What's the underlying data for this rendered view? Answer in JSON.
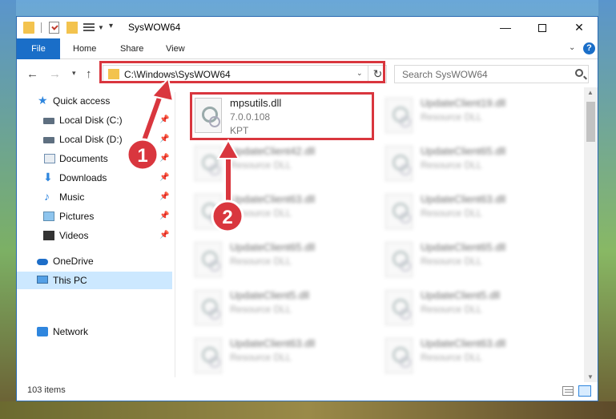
{
  "window": {
    "title": "SysWOW64"
  },
  "ribbon": {
    "tabs": [
      "File",
      "Home",
      "Share",
      "View"
    ]
  },
  "nav": {
    "address": "C:\\Windows\\SysWOW64",
    "search_placeholder": "Search SysWOW64"
  },
  "sidebar": {
    "items": [
      {
        "label": "Quick access",
        "icon": "star-icon",
        "pinned": false
      },
      {
        "label": "Local Disk (C:)",
        "icon": "disk-icon",
        "pinned": true
      },
      {
        "label": "Local Disk (D:)",
        "icon": "disk-icon",
        "pinned": true
      },
      {
        "label": "Documents",
        "icon": "documents-icon",
        "pinned": true
      },
      {
        "label": "Downloads",
        "icon": "download-icon",
        "pinned": true
      },
      {
        "label": "Music",
        "icon": "music-icon",
        "pinned": true
      },
      {
        "label": "Pictures",
        "icon": "pictures-icon",
        "pinned": true
      },
      {
        "label": "Videos",
        "icon": "videos-icon",
        "pinned": true
      },
      {
        "label": "OneDrive",
        "icon": "onedrive-icon",
        "pinned": false
      },
      {
        "label": "This PC",
        "icon": "pc-icon",
        "pinned": false,
        "selected": true
      },
      {
        "label": "Network",
        "icon": "network-icon",
        "pinned": false
      }
    ]
  },
  "files": [
    {
      "name": "mpsutils.dll",
      "line2": "7.0.0.108",
      "line3": "KPT",
      "highlighted": true
    },
    {
      "name": "UpdateClient19.dll",
      "line2": "Resource DLL",
      "blurred": true
    },
    {
      "name": "UpdateClient42.dll",
      "line2": "Resource DLL",
      "blurred": true
    },
    {
      "name": "UpdateClient65.dll",
      "line2": "Resource DLL",
      "blurred": true
    },
    {
      "name": "UpdateClient63.dll",
      "line2": "Resource DLL",
      "blurred": true
    },
    {
      "name": "UpdateClient63.dll",
      "line2": "Resource DLL",
      "blurred": true
    },
    {
      "name": "UpdateClient65.dll",
      "line2": "Resource DLL",
      "blurred": true
    },
    {
      "name": "UpdateClient65.dll",
      "line2": "Resource DLL",
      "blurred": true
    },
    {
      "name": "UpdateClient5.dll",
      "line2": "Resource DLL",
      "blurred": true
    },
    {
      "name": "UpdateClient5.dll",
      "line2": "Resource DLL",
      "blurred": true
    },
    {
      "name": "UpdateClient63.dll",
      "line2": "Resource DLL",
      "blurred": true
    },
    {
      "name": "UpdateClient63.dll",
      "line2": "Resource DLL",
      "blurred": true
    }
  ],
  "status": {
    "item_count": "103 items"
  },
  "annotations": {
    "badge1": "1",
    "badge2": "2",
    "color": "#d9363e"
  }
}
